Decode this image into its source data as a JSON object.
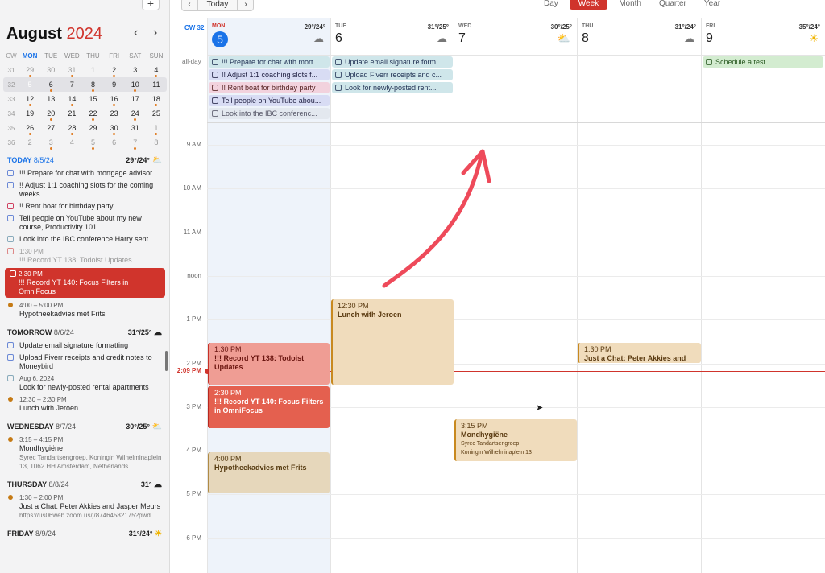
{
  "sidebar": {
    "add_label": "+",
    "month": "August",
    "year": "2024",
    "prev": "‹",
    "next": "›",
    "minical": {
      "headers": [
        "CW",
        "MON",
        "TUE",
        "WED",
        "THU",
        "FRI",
        "SAT",
        "SUN"
      ],
      "weeks": [
        {
          "cw": "31",
          "days": [
            "29",
            "30",
            "31",
            "1",
            "2",
            "3",
            "4"
          ]
        },
        {
          "cw": "32",
          "days": [
            "5",
            "6",
            "7",
            "8",
            "9",
            "10",
            "11"
          ]
        },
        {
          "cw": "33",
          "days": [
            "12",
            "13",
            "14",
            "15",
            "16",
            "17",
            "18"
          ]
        },
        {
          "cw": "34",
          "days": [
            "19",
            "20",
            "21",
            "22",
            "23",
            "24",
            "25"
          ]
        },
        {
          "cw": "35",
          "days": [
            "26",
            "27",
            "28",
            "29",
            "30",
            "31",
            "1"
          ]
        },
        {
          "cw": "36",
          "days": [
            "2",
            "3",
            "4",
            "5",
            "6",
            "7",
            "8"
          ]
        }
      ]
    },
    "agenda": [
      {
        "label": "TODAY",
        "date": "8/5/24",
        "temp": "29°/24°",
        "icon": "partly-cloudy-icon"
      },
      {
        "label": "TOMORROW",
        "date": "8/6/24",
        "temp": "31°/25°",
        "icon": "rain-cloud-icon"
      },
      {
        "label": "WEDNESDAY",
        "date": "8/7/24",
        "temp": "30°/25°",
        "icon": "partly-cloudy-icon"
      },
      {
        "label": "THURSDAY",
        "date": "8/8/24",
        "temp": "31°",
        "icon": "rain-cloud-icon"
      },
      {
        "label": "FRIDAY",
        "date": "8/9/24",
        "temp": "31°/24°",
        "icon": "sun-icon"
      }
    ],
    "today_items": [
      "!!! Prepare for chat with mortgage advisor",
      "!! Adjust 1:1 coaching slots for the coming weeks",
      "!! Rent boat for birthday party",
      "Tell people on YouTube about my new course, Productivity 101",
      "Look into the IBC conference Harry sent"
    ],
    "today_done": {
      "time": "1:30 PM",
      "title": "!!! Record YT 138: Todoist Updates"
    },
    "today_selected": {
      "time": "2:30 PM",
      "title": "!!! Record YT 140: Focus Filters in OmniFocus"
    },
    "today_event": {
      "time": "4:00 – 5:00 PM",
      "title": "Hypotheekadvies met Frits"
    },
    "tomorrow_items": [
      "Update email signature formatting",
      "Upload Fiverr receipts and credit notes to Moneybird"
    ],
    "tomorrow_recurring": {
      "time": "Aug 6, 2024",
      "title": "Look for newly-posted rental apartments"
    },
    "tomorrow_event": {
      "time": "12:30 – 2:30 PM",
      "title": "Lunch with Jeroen"
    },
    "wed_event": {
      "time": "3:15 – 4:15 PM",
      "title": "Mondhygiëne",
      "sub": "Syrec Tandartsengroep, Koningin Wilhelminaplein 13, 1062 HH Amsterdam, Netherlands"
    },
    "thu_event": {
      "time": "1:30 – 2:00 PM",
      "title": "Just a Chat: Peter Akkies and Jasper Meurs",
      "sub": "https://us06web.zoom.us/j/87464582175?pwd..."
    }
  },
  "toolbar": {
    "prev": "‹",
    "today": "Today",
    "next": "›",
    "views": [
      "Day",
      "Week",
      "Month",
      "Quarter",
      "Year"
    ],
    "active_view": "Week"
  },
  "week": {
    "cw": "CW 32",
    "allday_label": "all-day",
    "days": [
      {
        "name": "MON",
        "num": "5",
        "temp": "29°/24°",
        "icon": "rain-cloud-icon"
      },
      {
        "name": "TUE",
        "num": "6",
        "temp": "31°/25°",
        "icon": "rain-cloud-icon"
      },
      {
        "name": "WED",
        "num": "7",
        "temp": "30°/25°",
        "icon": "partly-cloudy-icon"
      },
      {
        "name": "THU",
        "num": "8",
        "temp": "31°/24°",
        "icon": "rain-cloud-icon"
      },
      {
        "name": "FRI",
        "num": "9",
        "temp": "35°/24°",
        "icon": "sun-icon"
      }
    ],
    "hours": [
      "9 AM",
      "10 AM",
      "11 AM",
      "noon",
      "1 PM",
      "2 PM",
      "3 PM",
      "4 PM",
      "5 PM",
      "6 PM"
    ],
    "now": "2:09 PM",
    "allday_mon": [
      "!!! Prepare for chat with mort...",
      "!! Adjust 1:1 coaching slots f...",
      "!! Rent boat for birthday party",
      "Tell people on YouTube abou...",
      "Look into the IBC conferenc..."
    ],
    "allday_tue": [
      "Update email signature form...",
      "Upload Fiverr receipts and c...",
      "Look for newly-posted rent..."
    ],
    "allday_fri": [
      "Schedule a test"
    ],
    "events": {
      "mon1": {
        "time": "1:30 PM",
        "title": "!!! Record YT 138: Todoist Updates"
      },
      "mon2": {
        "time": "2:30 PM",
        "title": "!!! Record YT 140: Focus Filters in OmniFocus"
      },
      "mon3": {
        "time": "4:00 PM",
        "title": "Hypotheekadvies met Frits"
      },
      "tue1": {
        "time": "12:30 PM",
        "title": "Lunch with Jeroen"
      },
      "wed1": {
        "time": "3:15 PM",
        "title": "Mondhygiëne",
        "sub1": "Syrec Tandartsengroep",
        "sub2": "Koningin Wilhelminaplein 13"
      },
      "thu1": {
        "time": "1:30 PM",
        "title": "Just a Chat: Peter Akkies and J..."
      }
    }
  },
  "colors": {
    "accent": "#d0342c",
    "today": "#1a73e8",
    "event_tan": "#f0dcbc"
  }
}
